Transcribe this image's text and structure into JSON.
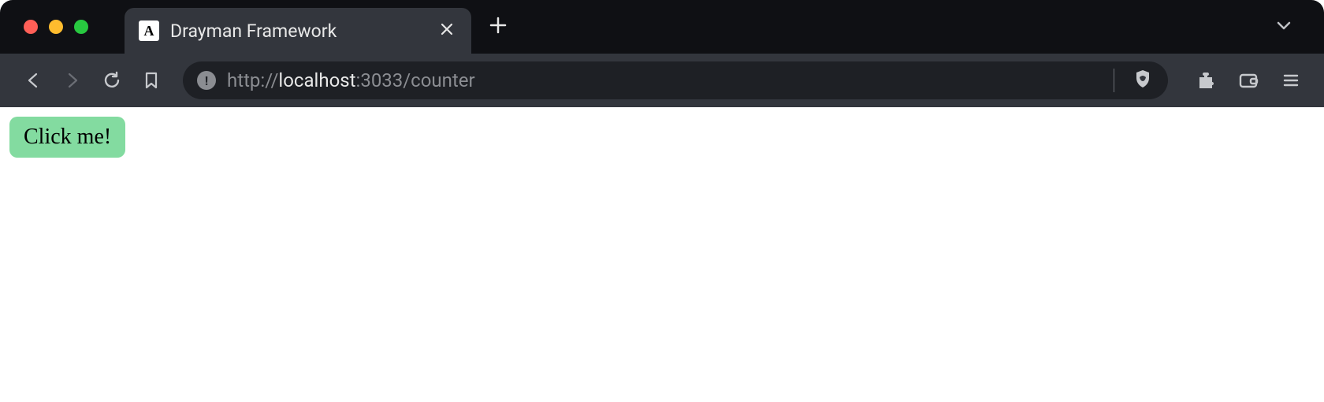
{
  "window": {
    "tab": {
      "favicon_letter": "A",
      "title": "Drayman Framework"
    }
  },
  "address": {
    "protocol": "http://",
    "host": "localhost",
    "port": ":3033",
    "path": "/counter"
  },
  "page": {
    "button_label": "Click me!"
  },
  "colors": {
    "chrome_bg": "#0f1014",
    "toolbar_bg": "#33363d",
    "address_bg": "#1e2025",
    "button_bg": "#83dba0"
  }
}
